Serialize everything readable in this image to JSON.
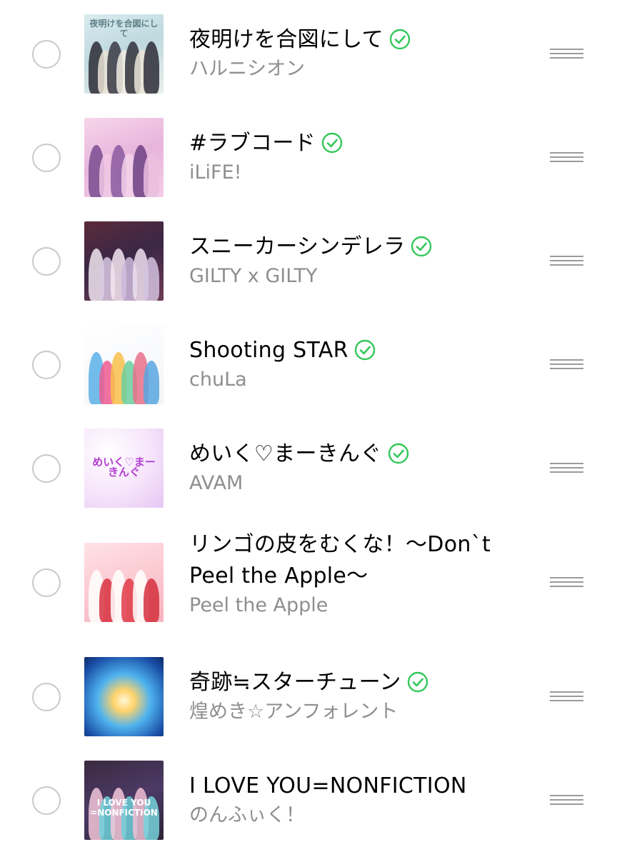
{
  "songs": [
    {
      "title": "夜明けを合図にして",
      "artist": "ハルニシオン",
      "verified": true,
      "art": {
        "bg": "linear-gradient(160deg,#d9ecef 0%,#bfd9df 45%,#e9efe9 100%)",
        "people": [
          "#2b2b35",
          "#e9e2d6",
          "#3a3a44",
          "#f1ece3",
          "#30303a",
          "#ebe4d8",
          "#2d2d37"
        ],
        "caption": "夜明けを合図にして",
        "captionColor": "#5e7e86"
      }
    },
    {
      "title": "#ラブコード",
      "artist": "iLiFE!",
      "verified": true,
      "art": {
        "bg": "linear-gradient(160deg,#f7d6ea 0%,#e7b4dc 50%,#f5cde6 100%)",
        "people": [
          "#7a4c8f",
          "#f0c8e4",
          "#8a5aa0",
          "#f3d2ea",
          "#6c3f82",
          "#eac0de"
        ],
        "caption": "",
        "captionColor": "#c2418f"
      }
    },
    {
      "title": "スニーカーシンデレラ",
      "artist": "GILTY x GILTY",
      "verified": true,
      "art": {
        "bg": "linear-gradient(160deg,#5b2b3a 0%,#3b2746 45%,#6d3b52 100%)",
        "people": [
          "#f0e6f0",
          "#d8c9e3",
          "#f4e8f2",
          "#cbb8dc",
          "#ece0ee",
          "#d4c2e0"
        ],
        "caption": "",
        "captionColor": "#ffffff"
      }
    },
    {
      "title": "Shooting STAR",
      "artist": "chuLa",
      "verified": true,
      "art": {
        "bg": "linear-gradient(160deg,#ffffff 0%,#f2f4f8 100%)",
        "people": [
          "#5ab0e8",
          "#ef5b8f",
          "#f7c04a",
          "#6ccf9d",
          "#e8708a",
          "#58a6e0"
        ],
        "caption": "",
        "captionColor": "#333333"
      }
    },
    {
      "title": "めいく♡まーきんぐ",
      "artist": "AVAM",
      "verified": true,
      "art": {
        "bg": "radial-gradient(circle at 30% 30%,#ffffff 0%,#f6e4fb 55%,#e6c6f4 100%)",
        "people": [],
        "caption": "めいく♡まーきんぐ",
        "captionColor": "#b23fd0"
      }
    },
    {
      "title": "リンゴの皮をむくな！〜Don`t Peel the Apple〜",
      "artist": "Peel the Apple",
      "verified": false,
      "art": {
        "bg": "linear-gradient(160deg,#ffe2e6 0%,#fbc7cf 55%,#f6b2bd 100%)",
        "people": [
          "#ffffff",
          "#d8323f",
          "#ffffff",
          "#e03b48",
          "#ffffff",
          "#d52f3c"
        ],
        "caption": "",
        "captionColor": "#d6213a"
      }
    },
    {
      "title": "奇跡≒スターチューン",
      "artist": "煌めき☆アンフォレント",
      "verified": true,
      "art": {
        "bg": "radial-gradient(circle at 50% 55%,#fff6d8 0%,#ffd36b 18%,#4fb3ee 45%,#1a4fa8 80%,#0e2b66 100%)",
        "people": [],
        "caption": "",
        "captionColor": "#ff5aa8"
      }
    },
    {
      "title": "I LOVE YOU=NONFICTION",
      "artist": "のんふぃく！",
      "verified": false,
      "art": {
        "bg": "linear-gradient(160deg,#3a2a3f 0%,#4c3a66 50%,#2e2336 100%)",
        "people": [
          "#f2c6d8",
          "#6fd1d9",
          "#f5c8da",
          "#6ccfd8",
          "#efc0d4",
          "#74d3dc"
        ],
        "caption": "I LOVE YOU =NONFICTION",
        "captionColor": "#ffffff"
      }
    }
  ],
  "colors": {
    "check": "#34c759",
    "radioBorder": "#c9c9c9",
    "handle": "#9b9b9b",
    "artist": "#8e8e8e"
  }
}
